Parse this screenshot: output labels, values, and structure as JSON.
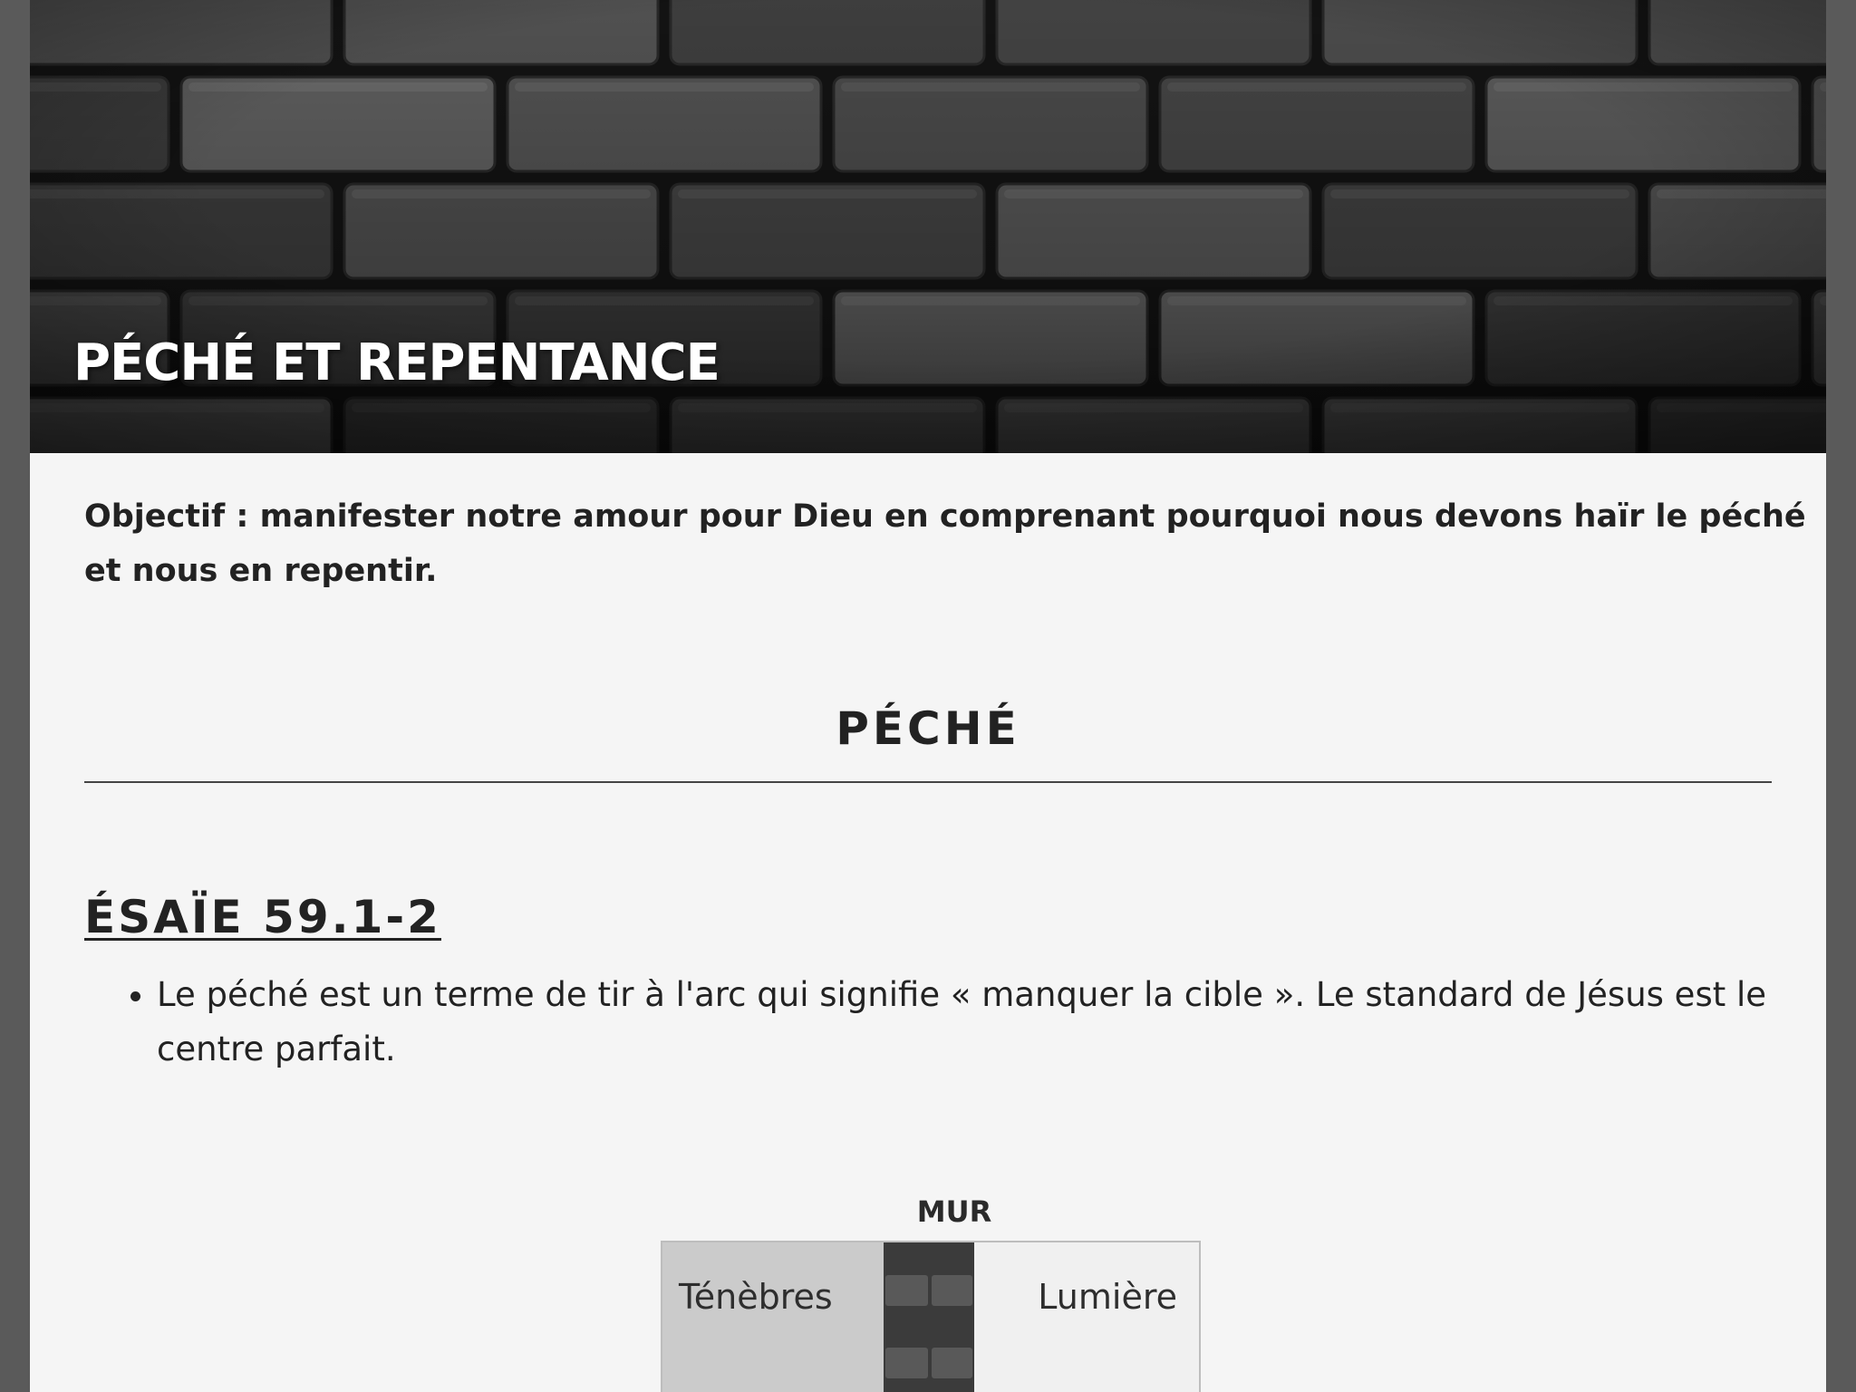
{
  "hero": {
    "title": "PÉCHÉ ET REPENTANCE",
    "image": "dark-brick-wall"
  },
  "objective": "Objectif : manifester notre amour pour Dieu en comprenant pourquoi nous devons haïr le péché et nous en repentir.",
  "section": {
    "heading": "PÉCHÉ"
  },
  "reference": {
    "heading": "ÉSAÏE 59.1-2",
    "bullets": [
      "Le péché est un terme de tir à l'arc qui signifie « manquer la cible ». Le standard de Jésus est le centre parfait."
    ]
  },
  "diagram": {
    "wall_label": "MUR",
    "left_label": "Ténèbres",
    "right_label": "Lumière"
  }
}
